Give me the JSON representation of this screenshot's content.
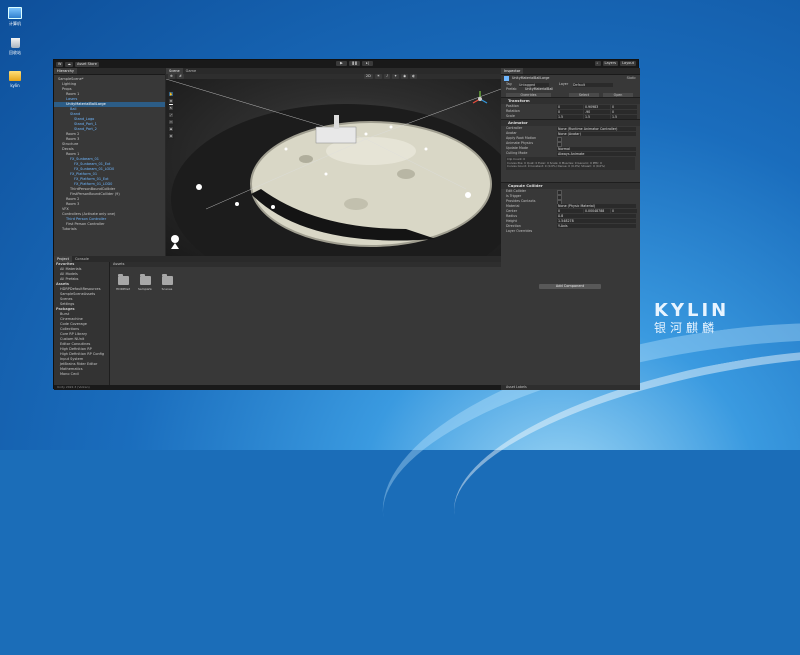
{
  "desktop": {
    "icons": [
      {
        "label": "计算机",
        "icon": "computer-icon"
      },
      {
        "label": "回收站",
        "icon": "trash-icon"
      },
      {
        "label": "kylin",
        "icon": "folder-icon"
      }
    ],
    "brand": {
      "name": "KYLIN",
      "sub": "银河麒麟"
    }
  },
  "toolbar": {
    "account": "W",
    "asset_store": "Asset Store",
    "layers": "Layers",
    "layout": "Layout"
  },
  "hierarchy": {
    "tab": "Hierarchy",
    "rows": [
      {
        "label": "SampleScene*",
        "indent": 1,
        "style": "normal"
      },
      {
        "label": "Lighting",
        "indent": 2,
        "style": "normal"
      },
      {
        "label": "Props",
        "indent": 2,
        "style": "normal"
      },
      {
        "label": "Room 1",
        "indent": 3,
        "style": "normal"
      },
      {
        "label": "Lasers",
        "indent": 3,
        "style": "blue"
      },
      {
        "label": "UnityMaterialBallLarge",
        "indent": 3,
        "style": "sel"
      },
      {
        "label": "Ball",
        "indent": 4,
        "style": "blue"
      },
      {
        "label": "Stand",
        "indent": 4,
        "style": "blue"
      },
      {
        "label": "Stand_Logo",
        "indent": 5,
        "style": "blue"
      },
      {
        "label": "Stand_Part_1",
        "indent": 5,
        "style": "blue"
      },
      {
        "label": "Stand_Part_2",
        "indent": 5,
        "style": "blue"
      },
      {
        "label": "Room 2",
        "indent": 3,
        "style": "normal"
      },
      {
        "label": "Room 3",
        "indent": 3,
        "style": "normal"
      },
      {
        "label": "Structure",
        "indent": 2,
        "style": "normal"
      },
      {
        "label": "Decals",
        "indent": 2,
        "style": "normal"
      },
      {
        "label": "Room 1",
        "indent": 3,
        "style": "normal"
      },
      {
        "label": "FX_Sunbeam_01",
        "indent": 4,
        "style": "blue"
      },
      {
        "label": "FX_Sunbeam_01_Ext",
        "indent": 5,
        "style": "blue"
      },
      {
        "label": "FX_Sunbeam_01_LOD0",
        "indent": 5,
        "style": "blue"
      },
      {
        "label": "FX_Platform_01",
        "indent": 4,
        "style": "blue"
      },
      {
        "label": "FX_Platform_01_Ext",
        "indent": 5,
        "style": "blue"
      },
      {
        "label": "FX_Platform_01_LOD0",
        "indent": 5,
        "style": "blue"
      },
      {
        "label": "ThirdPersonBoundCollider",
        "indent": 4,
        "style": "normal"
      },
      {
        "label": "FirstPersonBoundCollider (9)",
        "indent": 4,
        "style": "normal"
      },
      {
        "label": "Room 2",
        "indent": 3,
        "style": "normal"
      },
      {
        "label": "Room 3",
        "indent": 3,
        "style": "normal"
      },
      {
        "label": "VFX",
        "indent": 2,
        "style": "normal"
      },
      {
        "label": "Controllers (Activate only one)",
        "indent": 2,
        "style": "normal"
      },
      {
        "label": "Third Person Controller",
        "indent": 3,
        "style": "blue"
      },
      {
        "label": "First Person Controller",
        "indent": 3,
        "style": "normal"
      },
      {
        "label": "Tutorials",
        "indent": 2,
        "style": "normal"
      }
    ]
  },
  "scene": {
    "tabs": [
      "Scene",
      "Game"
    ],
    "shading": "2D",
    "tools": [
      "hand-tool",
      "move-tool",
      "rotate-tool",
      "scale-tool",
      "rect-tool",
      "transform-tool",
      "custom-tool"
    ]
  },
  "project": {
    "tabs": [
      "Project",
      "Console"
    ],
    "favorites_title": "Favorites",
    "favorites": [
      "All Materials",
      "All Models",
      "All Prefabs"
    ],
    "assets_title": "Assets",
    "assets_children": [
      "HDRPDefaultResources",
      "SampleSceneAssets",
      "Scenes",
      "Settings"
    ],
    "packages_title": "Packages",
    "packages": [
      "Burst",
      "Cinemachine",
      "Code Coverage",
      "Collections",
      "Core RP Library",
      "Custom NUnit",
      "Editor Coroutines",
      "High Definition RP",
      "High Definition RP Config",
      "Input System",
      "JetBrains Rider Editor",
      "Mathematics",
      "Mono Cecil"
    ],
    "breadcrumb": "Assets",
    "folders": [
      "HDRPDefau...",
      "SampleSce...",
      "Scenes"
    ]
  },
  "inspector": {
    "tab": "Inspector",
    "object_name": "UnityMaterialBallLarge",
    "static_label": "Static",
    "tag_label": "Tag",
    "tag_value": "Untagged",
    "layer_label": "Layer",
    "layer_value": "Default",
    "prefab_label": "Prefab",
    "prefab_value": "UnityMaterialBall",
    "overrides": "Overrides",
    "select": "Select",
    "open": "Open",
    "transform": {
      "title": "Transform",
      "position": {
        "label": "Position",
        "x": "0",
        "y": "0.90983",
        "z": "0"
      },
      "rotation": {
        "label": "Rotation",
        "x": "0",
        "y": "-90",
        "z": "0"
      },
      "scale": {
        "label": "Scale",
        "x": "1.5",
        "y": "1.5",
        "z": "1.5"
      }
    },
    "animator": {
      "title": "Animator",
      "props": [
        {
          "k": "Controller",
          "v": "None (Runtime Animator Controller)"
        },
        {
          "k": "Avatar",
          "v": "None (Avatar)"
        },
        {
          "k": "Apply Root Motion",
          "v": ""
        },
        {
          "k": "Animate Physics",
          "v": ""
        },
        {
          "k": "Update Mode",
          "v": "Normal"
        },
        {
          "k": "Culling Mode",
          "v": "Always Animate"
        }
      ],
      "info_lines": [
        "Clip Count: 0",
        "Curves Pos: 0 Quat: 0 Euler: 0 Scale: 0 Muscles: 0 Generic: 0 PPtr: 0",
        "Curves Count: 0 Constant: 0 (0.0%) Dense: 0 (0.0%) Stream: 0 (0.0%)"
      ]
    },
    "capsule": {
      "title": "Capsule Collider",
      "props": [
        {
          "k": "Edit Collider",
          "v": ""
        },
        {
          "k": "Is Trigger",
          "v": ""
        },
        {
          "k": "Provides Contacts",
          "v": ""
        },
        {
          "k": "Material",
          "v": "None (Physic Material)"
        },
        {
          "k": "Center",
          "v": ""
        },
        {
          "k": "Radius",
          "v": "0.8"
        },
        {
          "k": "Height",
          "v": "1.548278"
        },
        {
          "k": "Direction",
          "v": "Y-Axis"
        }
      ],
      "center": {
        "x": "0",
        "y": "0.00048788",
        "z": "0"
      },
      "layer_overrides": "Layer Overrides"
    },
    "add_component": "Add Component",
    "asset_labels": "Asset Labels"
  },
  "status": {
    "text": "Unity 2022.3 (Vulkan)"
  }
}
